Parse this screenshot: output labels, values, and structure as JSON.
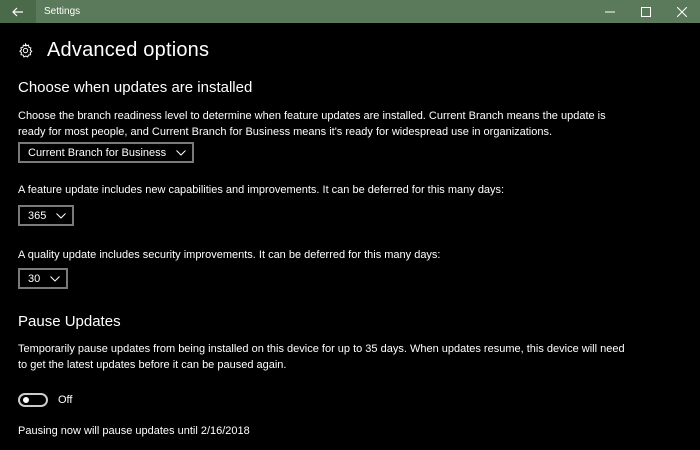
{
  "window": {
    "title": "Settings",
    "controls": [
      "minimize",
      "maximize",
      "close"
    ]
  },
  "header": {
    "title": "Advanced options",
    "icon": "gear-icon"
  },
  "choose_updates": {
    "heading": "Choose when updates are installed",
    "description": "Choose the branch readiness level to determine when feature updates are installed. Current Branch means the update is ready for most people, and Current Branch for Business means it's ready for widespread use in organizations.",
    "branch_select": {
      "selected": "Current Branch for Business"
    },
    "feature_text": "A feature update includes new capabilities and improvements. It can be deferred for this many days:",
    "feature_select": {
      "selected": "365"
    },
    "quality_text": "A quality update includes security improvements. It can be deferred for this many days:",
    "quality_select": {
      "selected": "30"
    }
  },
  "pause": {
    "heading": "Pause Updates",
    "description": "Temporarily pause updates from being installed on this device for up to 35 days. When updates resume, this device will need to get the latest updates before it can be paused again.",
    "toggle_state": "Off",
    "toggle_on": false,
    "note": "Pausing now will pause updates until 2/16/2018"
  },
  "colors": {
    "titlebar": "#5b7a5b",
    "background": "#000000",
    "text": "#ffffff"
  }
}
